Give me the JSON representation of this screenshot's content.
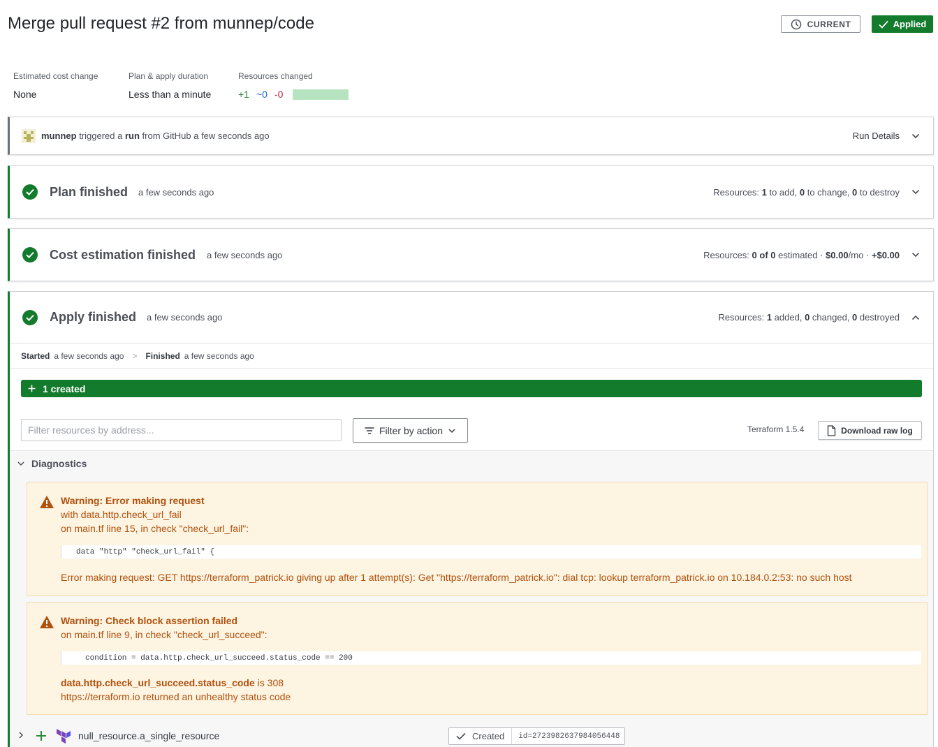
{
  "header": {
    "title": "Merge pull request #2 from munnep/code",
    "current_label": "CURRENT",
    "applied_label": "Applied"
  },
  "metrics": {
    "cost_label": "Estimated cost change",
    "cost_value": "None",
    "duration_label": "Plan & apply duration",
    "duration_value": "Less than a minute",
    "resources_label": "Resources changed",
    "added": "+1",
    "changed": "~0",
    "destroyed": "-0"
  },
  "trigger": {
    "user": "munnep",
    "text1": "triggered a",
    "run": "run",
    "text2": "from GitHub a few seconds ago",
    "details_label": "Run Details"
  },
  "plan": {
    "title": "Plan finished",
    "time": "a few seconds ago",
    "res_prefix": "Resources:",
    "add_n": "1",
    "add_t": "to add,",
    "change_n": "0",
    "change_t": "to change,",
    "destroy_n": "0",
    "destroy_t": "to destroy"
  },
  "cost": {
    "title": "Cost estimation finished",
    "time": "a few seconds ago",
    "res_prefix": "Resources:",
    "est": "0 of 0",
    "est_t": "estimated ·",
    "mo": "$0.00",
    "mo_t": "/mo ·",
    "delta": "+$0.00"
  },
  "apply": {
    "title": "Apply finished",
    "time": "a few seconds ago",
    "res_prefix": "Resources:",
    "added_n": "1",
    "added_t": "added,",
    "changed_n": "0",
    "changed_t": "changed,",
    "destroyed_n": "0",
    "destroyed_t": "destroyed",
    "started_label": "Started",
    "started_time": "a few seconds ago",
    "separator": ">",
    "finished_label": "Finished",
    "finished_time": "a few seconds ago",
    "created_bar": "1 created",
    "filter_placeholder": "Filter resources by address...",
    "filter_action_label": "Filter by action",
    "terraform_version": "Terraform 1.5.4",
    "download_label": "Download raw log"
  },
  "diagnostics": {
    "label": "Diagnostics",
    "warnings": [
      {
        "title": "Warning: Error making request",
        "line1": "with data.http.check_url_fail",
        "line2": "on main.tf line 15, in check \"check_url_fail\":",
        "code": "data \"http\" \"check_url_fail\" {",
        "detail": "Error making request: GET https://terraform_patrick.io giving up after 1 attempt(s): Get \"https://terraform_patrick.io\": dial tcp: lookup terraform_patrick.io on 10.184.0.2:53: no such host"
      },
      {
        "title": "Warning: Check block assertion failed",
        "line1": "on main.tf line 9, in check \"check_url_succeed\":",
        "code": "condition = data.http.check_url_succeed.status_code == 200",
        "detail_bold": "data.http.check_url_succeed.status_code",
        "detail_rest": " is 308",
        "detail2": "https://terraform.io returned an unhealthy status code"
      }
    ]
  },
  "resource": {
    "name": "null_resource.a_single_resource",
    "status": "Created",
    "id": "id=2723982637984056448"
  },
  "colors": {
    "success": "#127b2c",
    "warning_bg": "#fdf4e2",
    "warning_text": "#b0510d",
    "terraform_purple": "#7b42bc"
  }
}
